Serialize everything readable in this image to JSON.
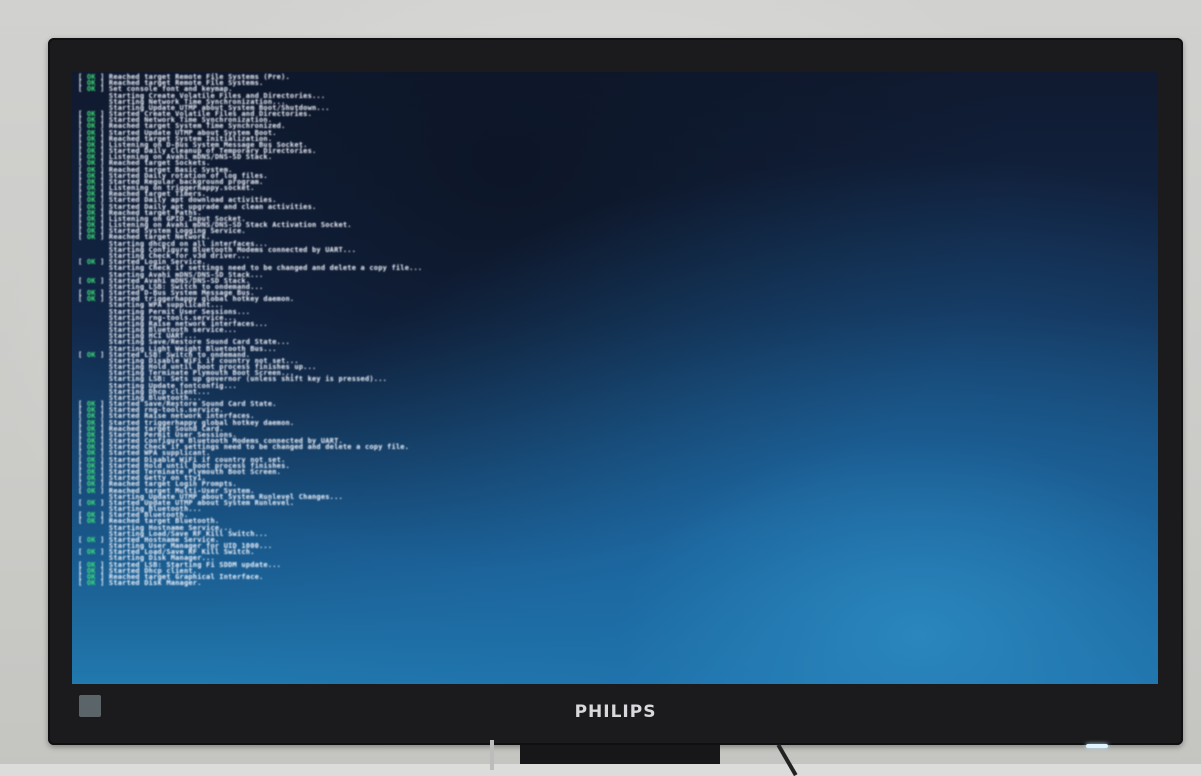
{
  "monitor": {
    "brand": "PHILIPS"
  },
  "boot_log": [
    {
      "status": "OK",
      "text": "] Reached target Remote File Systems (Pre)."
    },
    {
      "status": "OK",
      "text": "] Reached target Remote File Systems."
    },
    {
      "status": "OK",
      "text": "] Set console font and keymap."
    },
    {
      "status": "",
      "text": "  Starting Create Volatile Files and Directories..."
    },
    {
      "status": "",
      "text": "  Starting Network Time Synchronization..."
    },
    {
      "status": "",
      "text": "  Starting Update UTMP about System Boot/Shutdown..."
    },
    {
      "status": "OK",
      "text": "] Started Create Volatile Files and Directories."
    },
    {
      "status": "OK",
      "text": "] Started Network Time Synchronization."
    },
    {
      "status": "OK",
      "text": "] Reached target System Time Synchronized."
    },
    {
      "status": "OK",
      "text": "] Started Update UTMP about System Boot."
    },
    {
      "status": "OK",
      "text": "] Reached target System Initialization."
    },
    {
      "status": "OK",
      "text": "] Listening on D-Bus System Message Bus Socket."
    },
    {
      "status": "OK",
      "text": "] Started Daily Cleanup of Temporary Directories."
    },
    {
      "status": "OK",
      "text": "] Listening on Avahi mDNS/DNS-SD Stack."
    },
    {
      "status": "OK",
      "text": "] Reached target Sockets."
    },
    {
      "status": "OK",
      "text": "] Reached target Basic System."
    },
    {
      "status": "OK",
      "text": "] Started Daily rotation of log files."
    },
    {
      "status": "OK",
      "text": "] Started Regular background program."
    },
    {
      "status": "OK",
      "text": "] Listening on triggerhappy.socket."
    },
    {
      "status": "OK",
      "text": "] Reached target Timers."
    },
    {
      "status": "OK",
      "text": "] Started Daily apt download activities."
    },
    {
      "status": "OK",
      "text": "] Started Daily apt upgrade and clean activities."
    },
    {
      "status": "OK",
      "text": "] Reached target Paths."
    },
    {
      "status": "OK",
      "text": "] Listening on GPIO Input Socket."
    },
    {
      "status": "OK",
      "text": "] Listening on Avahi mDNS/DNS-SD Stack Activation Socket."
    },
    {
      "status": "OK",
      "text": "] Started System Logging Service."
    },
    {
      "status": "OK",
      "text": "] Reached target Network."
    },
    {
      "status": "",
      "text": "  Starting dhcpcd on all interfaces..."
    },
    {
      "status": "",
      "text": "  Starting Configure Bluetooth Modems connected by UART..."
    },
    {
      "status": "",
      "text": "  Starting Check for v3d driver..."
    },
    {
      "status": "OK",
      "text": "] Started Login Service."
    },
    {
      "status": "",
      "text": "  Starting Check if settings need to be changed and delete a copy file..."
    },
    {
      "status": "",
      "text": "  Starting Avahi mDNS/DNS-SD Stack..."
    },
    {
      "status": "OK",
      "text": "] Started Avahi mDNS/DNS-SD Stack."
    },
    {
      "status": "",
      "text": "  Starting LSB: Switch to ondemand..."
    },
    {
      "status": "OK",
      "text": "] Started D-Bus System Message Bus."
    },
    {
      "status": "OK",
      "text": "] Started triggerhappy global hotkey daemon."
    },
    {
      "status": "",
      "text": "  Starting WPA supplicant..."
    },
    {
      "status": "",
      "text": "  Starting Permit User Sessions..."
    },
    {
      "status": "",
      "text": "  Starting rng-tools.service..."
    },
    {
      "status": "",
      "text": "  Starting Raise network interfaces..."
    },
    {
      "status": "",
      "text": "  Starting Bluetooth service..."
    },
    {
      "status": "",
      "text": "  Starting HCI UART..."
    },
    {
      "status": "",
      "text": "  Starting Save/Restore Sound Card State..."
    },
    {
      "status": "",
      "text": "  Starting Light Weight Bluetooth Bus..."
    },
    {
      "status": "OK",
      "text": "] Started LSB: Switch to ondemand."
    },
    {
      "status": "",
      "text": "  Starting Disable WiFi if country not set..."
    },
    {
      "status": "",
      "text": "  Starting Hold until boot process finishes up..."
    },
    {
      "status": "",
      "text": "  Starting Terminate Plymouth Boot Screen..."
    },
    {
      "status": "",
      "text": "  Starting LSB: Sets up governor (unless shift key is pressed)..."
    },
    {
      "status": "",
      "text": "  Starting Update fontconfig..."
    },
    {
      "status": "",
      "text": "  Starting Dhcp client..."
    },
    {
      "status": "",
      "text": "  Starting Bluetooth..."
    },
    {
      "status": "OK",
      "text": "] Started Save/Restore Sound Card State."
    },
    {
      "status": "OK",
      "text": "] Started rng-tools.service."
    },
    {
      "status": "OK",
      "text": "] Started Raise network interfaces."
    },
    {
      "status": "OK",
      "text": "] Started triggerhappy global hotkey daemon."
    },
    {
      "status": "OK",
      "text": "] Reached target Sound Card."
    },
    {
      "status": "OK",
      "text": "] Started Permit User Sessions."
    },
    {
      "status": "OK",
      "text": "] Started Configure Bluetooth Modems connected by UART."
    },
    {
      "status": "OK",
      "text": "] Started Check if settings need to be changed and delete a copy file."
    },
    {
      "status": "OK",
      "text": "] Started WPA supplicant."
    },
    {
      "status": "OK",
      "text": "] Started Disable WiFi if country not set."
    },
    {
      "status": "OK",
      "text": "] Started Hold until boot process finishes."
    },
    {
      "status": "OK",
      "text": "] Started Terminate Plymouth Boot Screen."
    },
    {
      "status": "OK",
      "text": "] Started Getty on tty1."
    },
    {
      "status": "OK",
      "text": "] Reached target Login Prompts."
    },
    {
      "status": "OK",
      "text": "] Reached target Multi-User System."
    },
    {
      "status": "",
      "text": "  Starting Update UTMP about System Runlevel Changes..."
    },
    {
      "status": "OK",
      "text": "] Started Update UTMP about System Runlevel."
    },
    {
      "status": "",
      "text": "  Starting Bluetooth..."
    },
    {
      "status": "OK",
      "text": "] Started Bluetooth."
    },
    {
      "status": "OK",
      "text": "] Reached target Bluetooth."
    },
    {
      "status": "",
      "text": "  Starting Hostname Service..."
    },
    {
      "status": "",
      "text": "  Starting Load/Save RF Kill Switch..."
    },
    {
      "status": "OK",
      "text": "] Started Hostname Service."
    },
    {
      "status": "",
      "text": "  Starting User Manager for UID 1000..."
    },
    {
      "status": "OK",
      "text": "] Started Load/Save RF Kill Switch."
    },
    {
      "status": "",
      "text": "  Starting Disk Manager..."
    },
    {
      "status": "OK",
      "text": "] Started LSB: Starting Fi SDDM update..."
    },
    {
      "status": "OK",
      "text": "] Started Dhcp client."
    },
    {
      "status": "OK",
      "text": "] Reached target Graphical Interface."
    },
    {
      "status": "OK",
      "text": "] Started Disk Manager."
    }
  ]
}
